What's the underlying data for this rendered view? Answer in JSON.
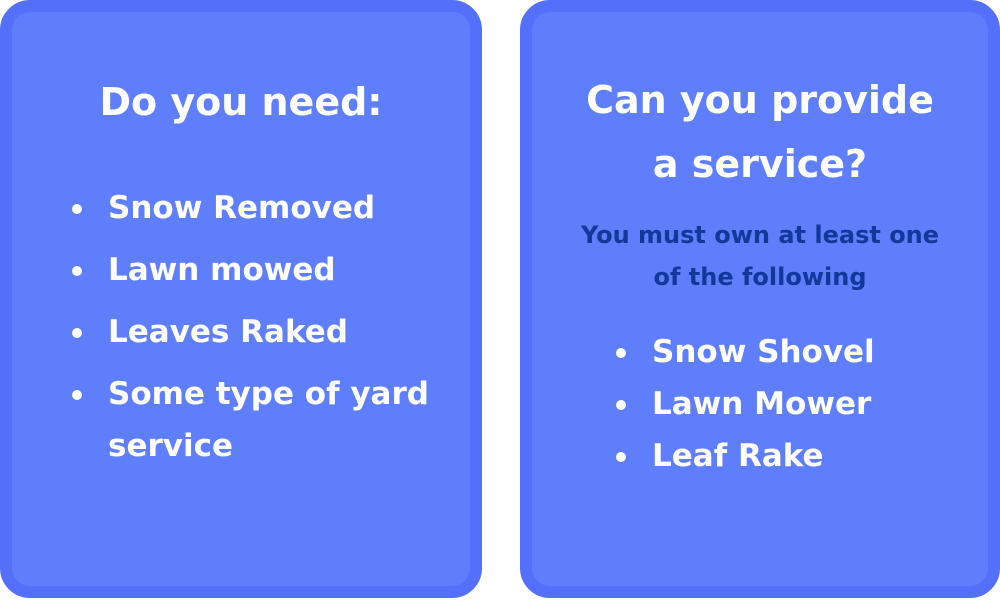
{
  "left_card": {
    "title": "Do you need:",
    "items": [
      "Snow Removed",
      "Lawn mowed",
      "Leaves Raked",
      "Some type of yard service"
    ]
  },
  "right_card": {
    "title_line1": "Can you provide",
    "title_line2": "a service?",
    "subtitle_line1": "You must own at least one",
    "subtitle_line2": "of the following",
    "items": [
      "Snow Shovel",
      "Lawn Mower",
      "Leaf Rake"
    ]
  },
  "colors": {
    "card_fill": "#5f7efb",
    "card_border": "#5470fb",
    "text_white": "#ffffff",
    "subtitle_blue": "#12389a"
  }
}
